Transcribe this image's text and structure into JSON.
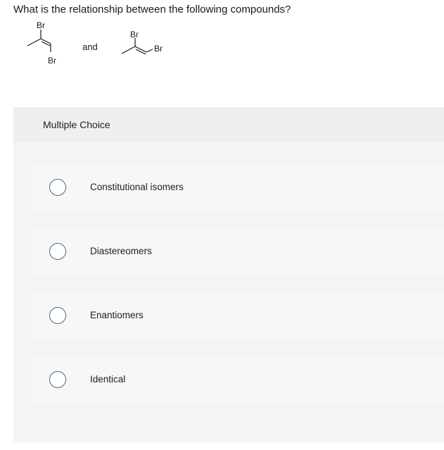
{
  "question": {
    "text": "What is the relationship between the following compounds?"
  },
  "structures": {
    "compound1": {
      "top_label": "Br",
      "bottom_label": "Br"
    },
    "connector": "and",
    "compound2": {
      "top_label": "Br",
      "right_label": "Br"
    }
  },
  "multiple_choice": {
    "title": "Multiple Choice",
    "options": [
      {
        "label": "Constitutional isomers",
        "selected": false
      },
      {
        "label": "Diastereomers",
        "selected": false
      },
      {
        "label": "Enantiomers",
        "selected": false
      },
      {
        "label": "Identical",
        "selected": false
      }
    ]
  },
  "colors": {
    "radio_border": "#3b6e8f",
    "panel_bg": "#f4f4f4",
    "option_bg": "#f7f7f7"
  }
}
